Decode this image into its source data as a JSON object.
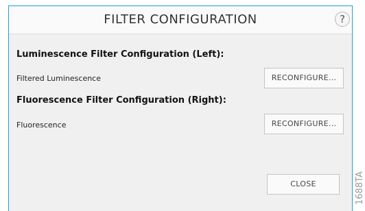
{
  "dialog": {
    "title": "FILTER CONFIGURATION",
    "help_label": "?",
    "sections": [
      {
        "heading": "Luminescence Filter Configuration (Left):",
        "filter_name": "Filtered Luminescence",
        "button_label": "RECONFIGURE..."
      },
      {
        "heading": "Fluorescence Filter Configuration (Right):",
        "filter_name": "Fluorescence",
        "button_label": "RECONFIGURE..."
      }
    ],
    "close_label": "CLOSE"
  },
  "watermark": "1688TA",
  "colors": {
    "border_accent": "#1e9fd8",
    "panel_background": "#f0f0f0",
    "button_background": "#fafafa"
  },
  "icons": {
    "help": "question-mark-circle-icon"
  }
}
